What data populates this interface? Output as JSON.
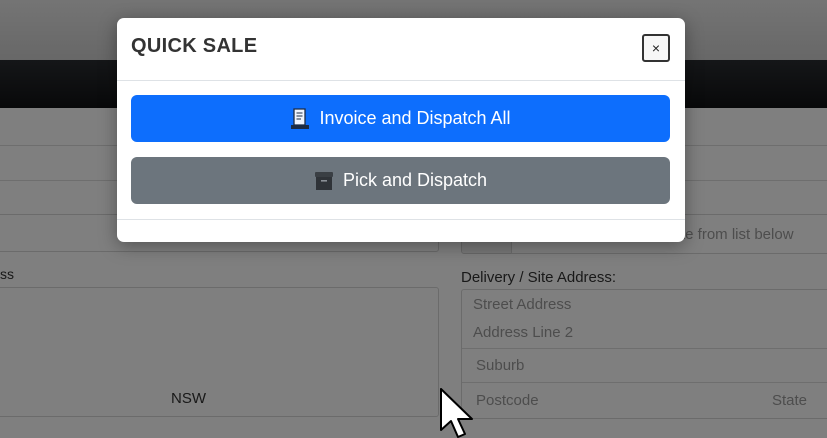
{
  "background": {
    "address_label_fragment": "ss",
    "state_value": "NSW",
    "site_search_placeholder_fragment": "te from list below",
    "delivery": {
      "label": "Delivery / Site Address:",
      "street_placeholder": "Street Address",
      "line2_placeholder": "Address Line 2",
      "suburb_placeholder": "Suburb",
      "postcode_placeholder": "Postcode",
      "state_placeholder": "State"
    }
  },
  "modal": {
    "title": "QUICK SALE",
    "close_label": "×",
    "buttons": {
      "invoice_dispatch_all": {
        "label": "Invoice and Dispatch All",
        "icon": "receipt-icon",
        "color": "#0d6efd"
      },
      "pick_dispatch": {
        "label": "Pick and Dispatch",
        "icon": "archive-box-icon",
        "color": "#6c757d"
      }
    }
  }
}
